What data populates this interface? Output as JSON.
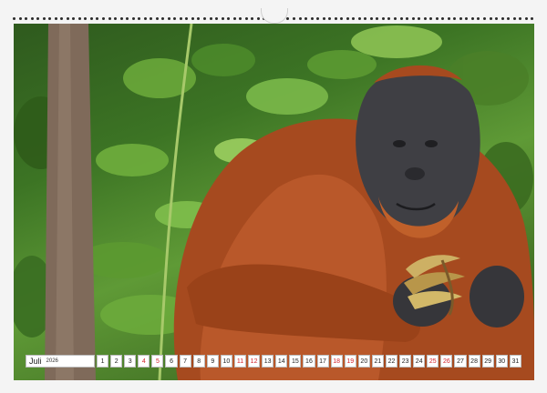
{
  "calendar": {
    "month": "Juli",
    "year": "2026",
    "days": [
      {
        "n": "1",
        "weekend": false
      },
      {
        "n": "2",
        "weekend": false
      },
      {
        "n": "3",
        "weekend": false
      },
      {
        "n": "4",
        "weekend": true
      },
      {
        "n": "5",
        "weekend": true
      },
      {
        "n": "6",
        "weekend": false
      },
      {
        "n": "7",
        "weekend": false
      },
      {
        "n": "8",
        "weekend": false
      },
      {
        "n": "9",
        "weekend": false
      },
      {
        "n": "10",
        "weekend": false
      },
      {
        "n": "11",
        "weekend": true
      },
      {
        "n": "12",
        "weekend": true
      },
      {
        "n": "13",
        "weekend": false
      },
      {
        "n": "14",
        "weekend": false
      },
      {
        "n": "15",
        "weekend": false
      },
      {
        "n": "16",
        "weekend": false
      },
      {
        "n": "17",
        "weekend": false
      },
      {
        "n": "18",
        "weekend": true
      },
      {
        "n": "19",
        "weekend": true
      },
      {
        "n": "20",
        "weekend": false
      },
      {
        "n": "21",
        "weekend": false
      },
      {
        "n": "22",
        "weekend": false
      },
      {
        "n": "23",
        "weekend": false
      },
      {
        "n": "24",
        "weekend": false
      },
      {
        "n": "25",
        "weekend": true
      },
      {
        "n": "26",
        "weekend": true
      },
      {
        "n": "27",
        "weekend": false
      },
      {
        "n": "28",
        "weekend": false
      },
      {
        "n": "29",
        "weekend": false
      },
      {
        "n": "30",
        "weekend": false
      },
      {
        "n": "31",
        "weekend": false
      }
    ]
  },
  "colors": {
    "weekend_red": "#d2232a",
    "fur": "#a64a1f",
    "face": "#3f3f44",
    "foliage": "#3c7424"
  }
}
